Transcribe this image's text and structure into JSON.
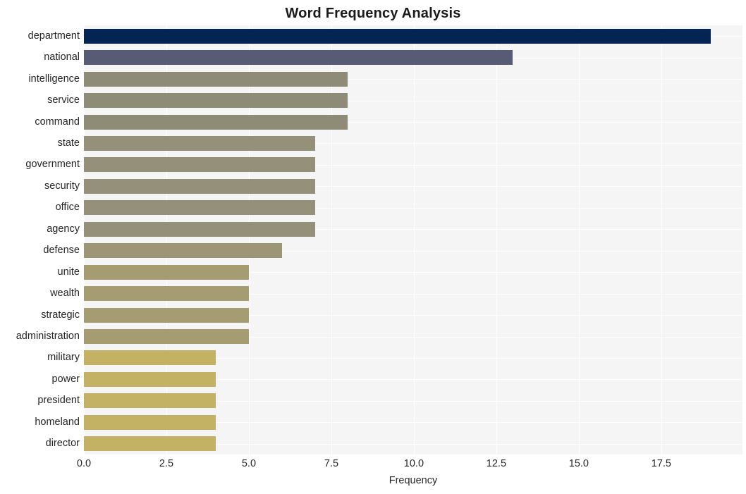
{
  "chart_data": {
    "type": "bar",
    "orientation": "horizontal",
    "title": "Word Frequency Analysis",
    "xlabel": "Frequency",
    "ylabel": "",
    "categories": [
      "department",
      "national",
      "intelligence",
      "service",
      "command",
      "state",
      "government",
      "security",
      "office",
      "agency",
      "defense",
      "unite",
      "wealth",
      "strategic",
      "administration",
      "military",
      "power",
      "president",
      "homeland",
      "director"
    ],
    "values": [
      19,
      13,
      8,
      8,
      8,
      7,
      7,
      7,
      7,
      7,
      6,
      5,
      5,
      5,
      5,
      4,
      4,
      4,
      4,
      4
    ],
    "xlim": [
      0,
      19.96
    ],
    "xticks": [
      0,
      2.5,
      5,
      7.5,
      10,
      12.5,
      15,
      17.5
    ],
    "xticklabels": [
      "0.0",
      "2.5",
      "5.0",
      "7.5",
      "10.0",
      "12.5",
      "15.0",
      "17.5"
    ],
    "grid": true,
    "legend": false,
    "bar_colors": [
      "#042453",
      "#575c74",
      "#8e8b77",
      "#8e8b77",
      "#8e8b77",
      "#94907a",
      "#94907a",
      "#94907a",
      "#94907a",
      "#94907a",
      "#9c9677",
      "#a59c71",
      "#a59c71",
      "#a59c71",
      "#a59c71",
      "#c3b264",
      "#c3b264",
      "#c3b264",
      "#c3b264",
      "#c3b264"
    ],
    "plot_background": "#f5f5f5",
    "figure_background": "#ffffff",
    "grid_color": "#ffffff",
    "title_color": "#1a1a1a",
    "tick_label_color": "#262626"
  }
}
